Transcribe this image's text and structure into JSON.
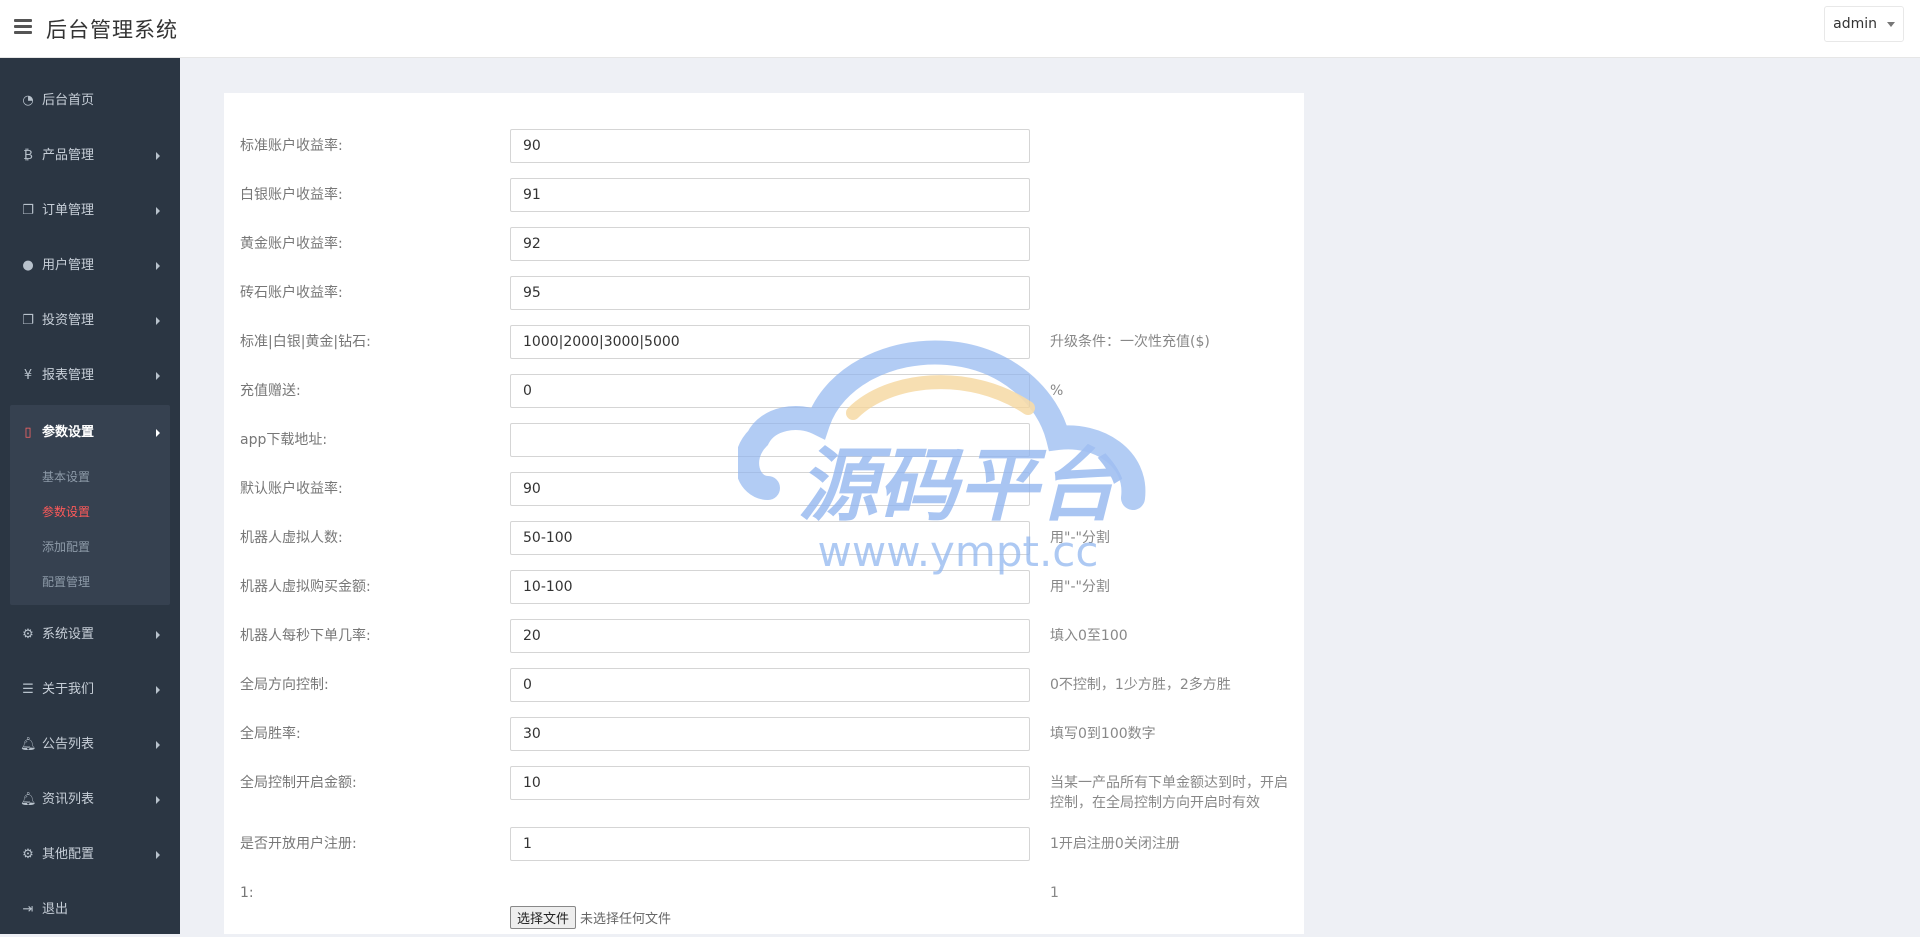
{
  "header": {
    "title": "后台管理系统",
    "user": "admin"
  },
  "sidebar": {
    "items": [
      {
        "label": "后台首页",
        "icon": "dashboard-icon"
      },
      {
        "label": "产品管理",
        "icon": "bitcoin-icon"
      },
      {
        "label": "订单管理",
        "icon": "copy-icon"
      },
      {
        "label": "用户管理",
        "icon": "user-icon"
      },
      {
        "label": "投资管理",
        "icon": "copy-icon"
      },
      {
        "label": "报表管理",
        "icon": "yen-icon"
      }
    ],
    "active_group": {
      "label": "参数设置",
      "icon": "file-icon",
      "children": [
        "基本设置",
        "参数设置",
        "添加配置",
        "配置管理"
      ]
    },
    "items_after": [
      {
        "label": "系统设置",
        "icon": "gears-icon"
      },
      {
        "label": "关于我们",
        "icon": "list-icon"
      },
      {
        "label": "公告列表",
        "icon": "bell-icon"
      },
      {
        "label": "资讯列表",
        "icon": "bell-icon"
      },
      {
        "label": "其他配置",
        "icon": "gear-icon"
      },
      {
        "label": "退出",
        "icon": "sign-out-icon"
      }
    ]
  },
  "form": {
    "fields": [
      {
        "label": "标准账户收益率:",
        "value": "90",
        "hint": ""
      },
      {
        "label": "白银账户收益率:",
        "value": "91",
        "hint": ""
      },
      {
        "label": "黄金账户收益率:",
        "value": "92",
        "hint": ""
      },
      {
        "label": "砖石账户收益率:",
        "value": "95",
        "hint": ""
      },
      {
        "label": "标准|白银|黄金|钻石:",
        "value": "1000|2000|3000|5000",
        "hint": "升级条件：一次性充值($)"
      },
      {
        "label": "充值赠送:",
        "value": "0",
        "hint": "%"
      },
      {
        "label": "app下载地址:",
        "value": "",
        "hint": ""
      },
      {
        "label": "默认账户收益率:",
        "value": "90",
        "hint": ""
      },
      {
        "label": "机器人虚拟人数:",
        "value": "50-100",
        "hint": "用\"-\"分割"
      },
      {
        "label": "机器人虚拟购买金额:",
        "value": "10-100",
        "hint": "用\"-\"分割"
      },
      {
        "label": "机器人每秒下单几率:",
        "value": "20",
        "hint": "填入0至100"
      },
      {
        "label": "全局方向控制:",
        "value": "0",
        "hint": "0不控制，1少方胜，2多方胜"
      },
      {
        "label": "全局胜率:",
        "value": "30",
        "hint": "填写0到100数字"
      },
      {
        "label": "全局控制开启金额:",
        "value": "10",
        "hint": "当某一产品所有下单金额达到时，开启控制，在全局控制方向开启时有效"
      },
      {
        "label": "是否开放用户注册:",
        "value": "1",
        "hint": "1开启注册0关闭注册"
      }
    ],
    "file_field": {
      "label": "1:",
      "hint": "1",
      "button": "选择文件",
      "status": "未选择任何文件"
    }
  },
  "watermark": {
    "text": "源码平台",
    "url": "www.ympt.cc",
    "color_blue": "#8fb4ef",
    "color_orange": "#f5d59a"
  },
  "colors": {
    "sidebar_bg": "#2b3643",
    "active_accent": "#ff5a5a"
  }
}
